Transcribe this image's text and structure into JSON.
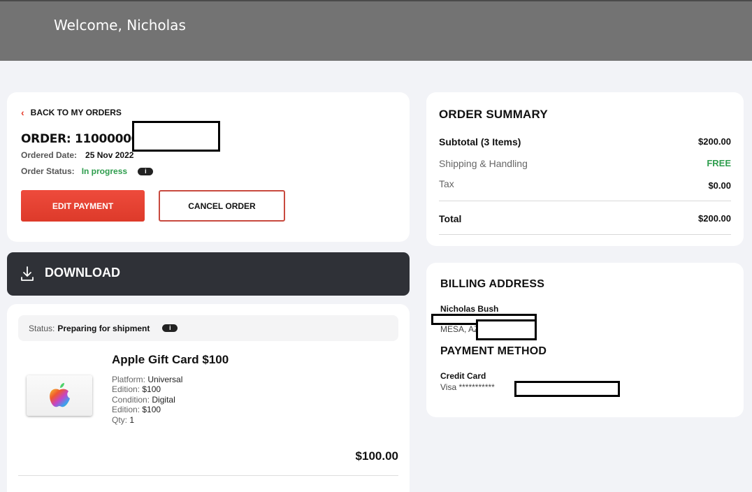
{
  "header": {
    "welcome": "Welcome, Nicholas"
  },
  "order": {
    "back_label": "BACK TO MY ORDERS",
    "order_number": "ORDER: 11000000",
    "ordered_date_label": "Ordered Date:",
    "ordered_date": "25 Nov 2022",
    "status_label": "Order Status:",
    "status": "In progress",
    "info_glyph": "i",
    "edit_payment": "EDIT PAYMENT",
    "cancel_order": "CANCEL ORDER"
  },
  "download": {
    "label": "DOWNLOAD",
    "icon": "download-icon"
  },
  "item": {
    "status_label": "Status:",
    "status": "Preparing for shipment",
    "title": "Apple Gift Card $100",
    "specs": [
      {
        "label": "Platform:",
        "value": "Universal"
      },
      {
        "label": "Edition:",
        "value": "$100"
      },
      {
        "label": "Condition:",
        "value": "Digital"
      },
      {
        "label": "Edition:",
        "value": "$100"
      },
      {
        "label": "Qty:",
        "value": "1"
      }
    ],
    "price": "$100.00"
  },
  "summary": {
    "title": "ORDER SUMMARY",
    "subtotal_label": "Subtotal (3 Items)",
    "subtotal": "$200.00",
    "shipping_label": "Shipping & Handling",
    "shipping": "FREE",
    "tax_label": "Tax",
    "tax": "$0.00",
    "total_label": "Total",
    "total": "$200.00"
  },
  "billing": {
    "title": "BILLING ADDRESS",
    "name": "Nicholas Bush",
    "city": "MESA, AZ"
  },
  "payment": {
    "title": "PAYMENT METHOD",
    "type": "Credit Card",
    "card": "Visa ***********"
  },
  "colors": {
    "accent_red": "#e53b2c",
    "status_green": "#2e9d4d",
    "header_gray": "#737373",
    "download_bar": "#2f3137"
  }
}
